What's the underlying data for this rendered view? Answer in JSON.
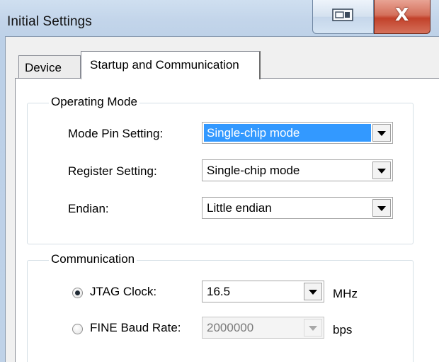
{
  "window": {
    "title": "Initial Settings",
    "close_label": "X"
  },
  "tabs": [
    {
      "label": "Device",
      "selected": false
    },
    {
      "label": "Startup and Communication",
      "selected": true
    }
  ],
  "operating_mode": {
    "legend": "Operating Mode",
    "mode_pin": {
      "label": "Mode Pin Setting:",
      "value": "Single-chip mode",
      "focused": true
    },
    "register": {
      "label": "Register Setting:",
      "value": "Single-chip mode"
    },
    "endian": {
      "label": "Endian:",
      "value": "Little endian"
    }
  },
  "communication": {
    "legend": "Communication",
    "jtag": {
      "label": "JTAG Clock:",
      "value": "16.5",
      "unit": "MHz",
      "selected": true
    },
    "fine": {
      "label": "FINE Baud Rate:",
      "value": "2000000",
      "unit": "bps",
      "selected": false,
      "enabled": false
    }
  },
  "colors": {
    "selection": "#3399ff",
    "close_button": "#c8452f",
    "title_bar": "#c3d5ea"
  },
  "icons": {
    "restore": "restore-icon",
    "close": "close-icon",
    "dropdown": "chevron-down-icon"
  }
}
